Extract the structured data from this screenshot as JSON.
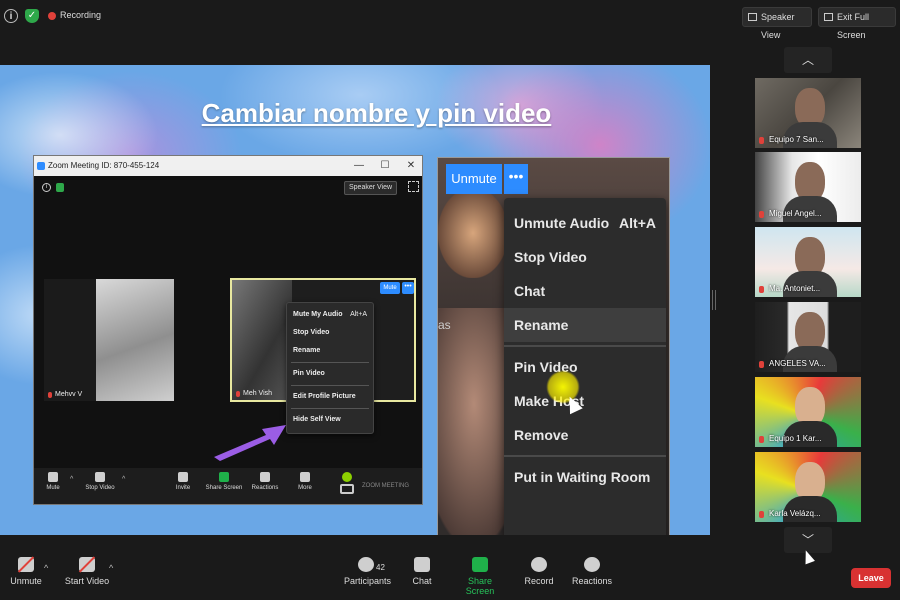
{
  "topbar": {
    "recording_label": "Recording",
    "speaker_view_label": "Speaker View",
    "exit_fullscreen_label": "Exit Full Screen"
  },
  "slide": {
    "title": "Cambiar nombre  y pin video",
    "zoom_window": {
      "title": "Zoom Meeting ID: 870-455-124",
      "speaker_view_label": "Speaker View",
      "tiles": [
        {
          "name": "Mehvv V"
        },
        {
          "name": "Meh Vish",
          "mute_label": "Mute",
          "more_label": "•••"
        }
      ],
      "menu": [
        {
          "label": "Mute My Audio",
          "shortcut": "Alt+A"
        },
        {
          "label": "Stop Video"
        },
        {
          "label": "Rename"
        },
        {
          "label": "Pin Video"
        },
        {
          "label": "Edit Profile Picture"
        },
        {
          "label": "Hide Self View"
        }
      ],
      "toolbar": {
        "mute": "Mute",
        "stop_video": "Stop Video",
        "invite": "Invite",
        "share_screen": "Share Screen",
        "reactions": "Reactions",
        "more": "More",
        "brand": "ZOOM MEETING"
      }
    },
    "zoomed": {
      "unmute_label": "Unmute",
      "more_label": "•••",
      "partial_text": "as",
      "menu": [
        {
          "label": "Unmute Audio",
          "shortcut": "Alt+A"
        },
        {
          "label": "Stop Video"
        },
        {
          "label": "Chat"
        },
        {
          "label": "Rename"
        },
        {
          "label": "Pin Video"
        },
        {
          "label": "Make Host"
        },
        {
          "label": "Remove"
        },
        {
          "label": "Put in Waiting Room"
        }
      ]
    }
  },
  "gallery": {
    "participants": [
      {
        "name": "Equipo 7 San..."
      },
      {
        "name": "Miguel Angel..."
      },
      {
        "name": "Ma. Antoniet..."
      },
      {
        "name": "ANGELES VA..."
      },
      {
        "name": "Equipo 1 Kar..."
      },
      {
        "name": "Karla Velázq..."
      }
    ]
  },
  "bottombar": {
    "unmute": "Unmute",
    "start_video": "Start Video",
    "participants": "Participants",
    "participants_count": "42",
    "chat": "Chat",
    "share_screen": "Share Screen",
    "record": "Record",
    "reactions": "Reactions",
    "leave": "Leave"
  },
  "colors": {
    "accent": "#2d8cff",
    "leave": "#d83232",
    "share_green": "#1fb14a",
    "recording": "#e0413a"
  }
}
